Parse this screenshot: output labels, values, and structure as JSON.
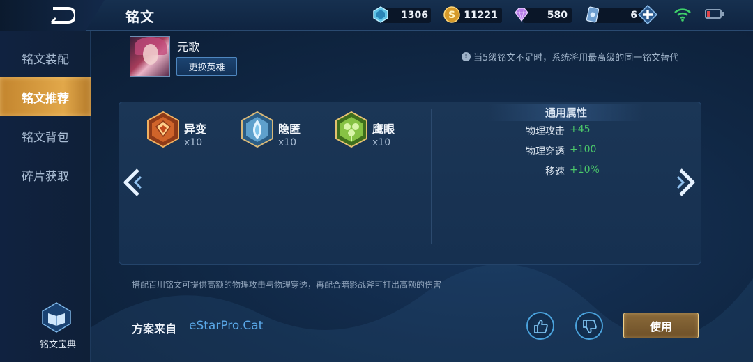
{
  "header": {
    "title": "铭文",
    "currencies": [
      {
        "name": "crystal",
        "value": "1306"
      },
      {
        "name": "gold-coin",
        "value": "11221"
      },
      {
        "name": "diamond",
        "value": "580"
      },
      {
        "name": "ticket",
        "value": "6"
      }
    ]
  },
  "sidebar": {
    "items": [
      {
        "label": "铭文装配",
        "active": false
      },
      {
        "label": "铭文推荐",
        "active": true
      },
      {
        "label": "铭文背包",
        "active": false
      },
      {
        "label": "碎片获取",
        "active": false
      }
    ],
    "codex_label": "铭文宝典"
  },
  "hero": {
    "name": "元歌",
    "change_button": "更换英雄"
  },
  "notice": "当5级铭文不足时，系统将用最高级的同一铭文替代",
  "runes": [
    {
      "name": "异变",
      "count": "x10",
      "color": "#c0642a"
    },
    {
      "name": "隐匿",
      "count": "x10",
      "color": "#4c88b6"
    },
    {
      "name": "鹰眼",
      "count": "x10",
      "color": "#6aa832"
    }
  ],
  "attributes": {
    "title": "通用属性",
    "rows": [
      {
        "label": "物理攻击",
        "value": "+45"
      },
      {
        "label": "物理穿透",
        "value": "+100"
      },
      {
        "label": "移速",
        "value": "+10%"
      }
    ]
  },
  "description": "搭配百川铭文可提供高额的物理攻击与物理穿透，再配合暗影战斧可打出高额的伤害",
  "source": {
    "label": "方案来自",
    "value": "eStarPro.Cat"
  },
  "actions": {
    "use_label": "使用"
  },
  "colors": {
    "accent_gold": "#e2a84a",
    "positive_green": "#4bc86a",
    "link_blue": "#5aa8e8"
  }
}
